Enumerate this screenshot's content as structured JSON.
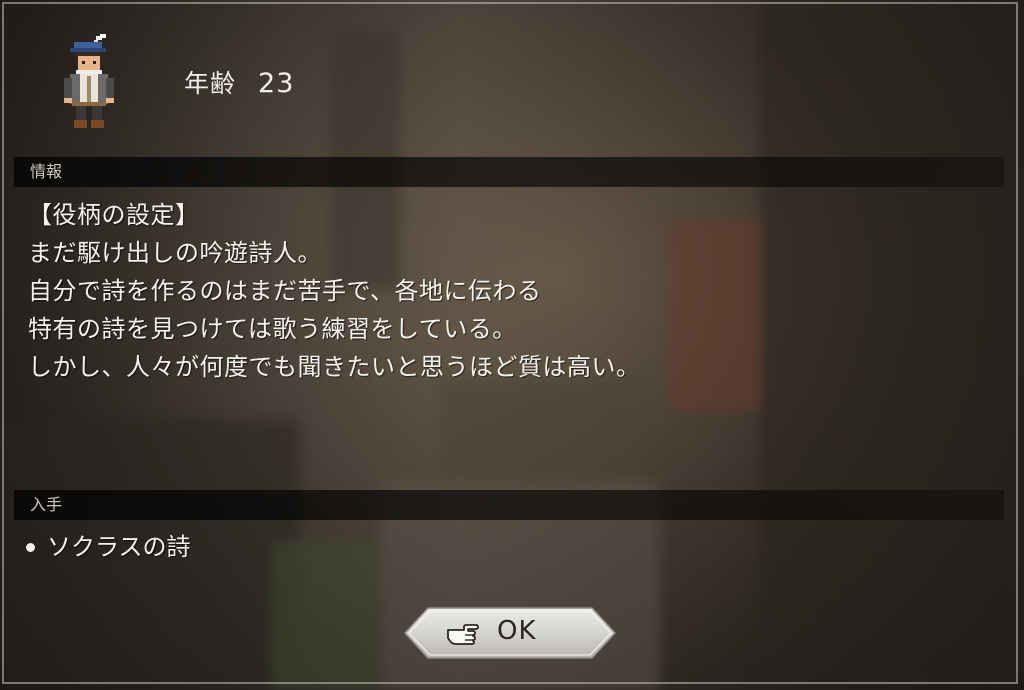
{
  "character": {
    "age_label": "年齢",
    "age_value": "23",
    "portrait_icon": "bard-sprite-icon"
  },
  "info_section": {
    "header": "情報",
    "lines": [
      "【役柄の設定】",
      "まだ駆け出しの吟遊詩人。",
      "自分で詩を作るのはまだ苦手で、各地に伝わる",
      "特有の詩を見つけては歌う練習をしている。",
      "しかし、人々が何度でも聞きたいと思うほど質は高い。"
    ]
  },
  "acquire_section": {
    "header": "入手",
    "items": [
      "ソクラスの詩"
    ]
  },
  "ok_button": {
    "label": "OK",
    "icon": "pointing-hand-icon"
  },
  "colors": {
    "text": "#f4f2ec",
    "header_bar": "#000000",
    "button_plate": "#d8d6d2"
  }
}
